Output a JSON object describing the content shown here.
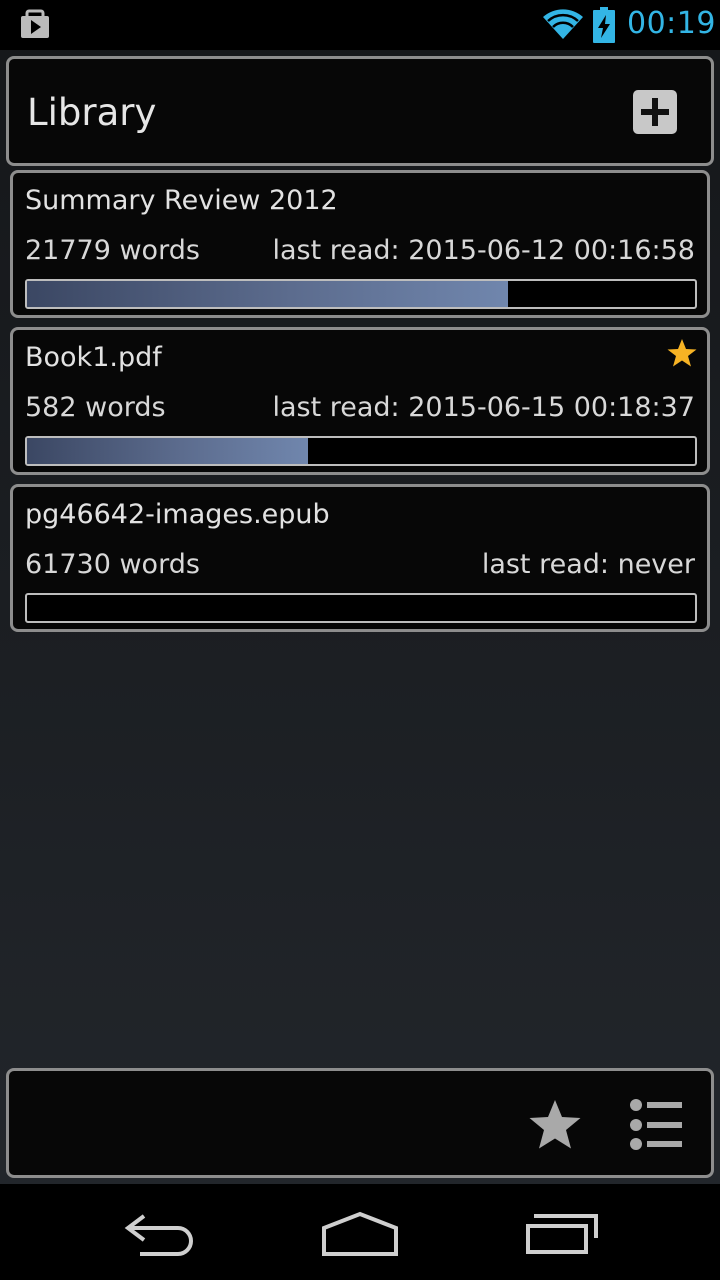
{
  "status_bar": {
    "time": "00:19",
    "icons": [
      "media-play-icon",
      "wifi-icon",
      "battery-charging-icon"
    ],
    "accent_color": "#33b5e5"
  },
  "header": {
    "title": "Library",
    "add_icon": "plus-icon"
  },
  "books": [
    {
      "title": "Summary Review 2012",
      "words": "21779 words",
      "last_read": "last read: 2015-06-12 00:16:58",
      "progress": 0.72,
      "starred": false
    },
    {
      "title": "Book1.pdf",
      "words": "582 words",
      "last_read": "last read: 2015-06-15 00:18:37",
      "progress": 0.42,
      "starred": true
    },
    {
      "title": "pg46642-images.epub",
      "words": "61730 words",
      "last_read": "last read: never",
      "progress": 0,
      "starred": false
    }
  ],
  "bottom_bar": {
    "icons": [
      "star-icon",
      "list-icon"
    ]
  },
  "navigation": {
    "icons": [
      "back-icon",
      "home-icon",
      "recents-icon"
    ]
  },
  "colors": {
    "star": "#f7b324",
    "progress_fill": "#5c6c8e",
    "panel_border": "#8d8d8d"
  }
}
